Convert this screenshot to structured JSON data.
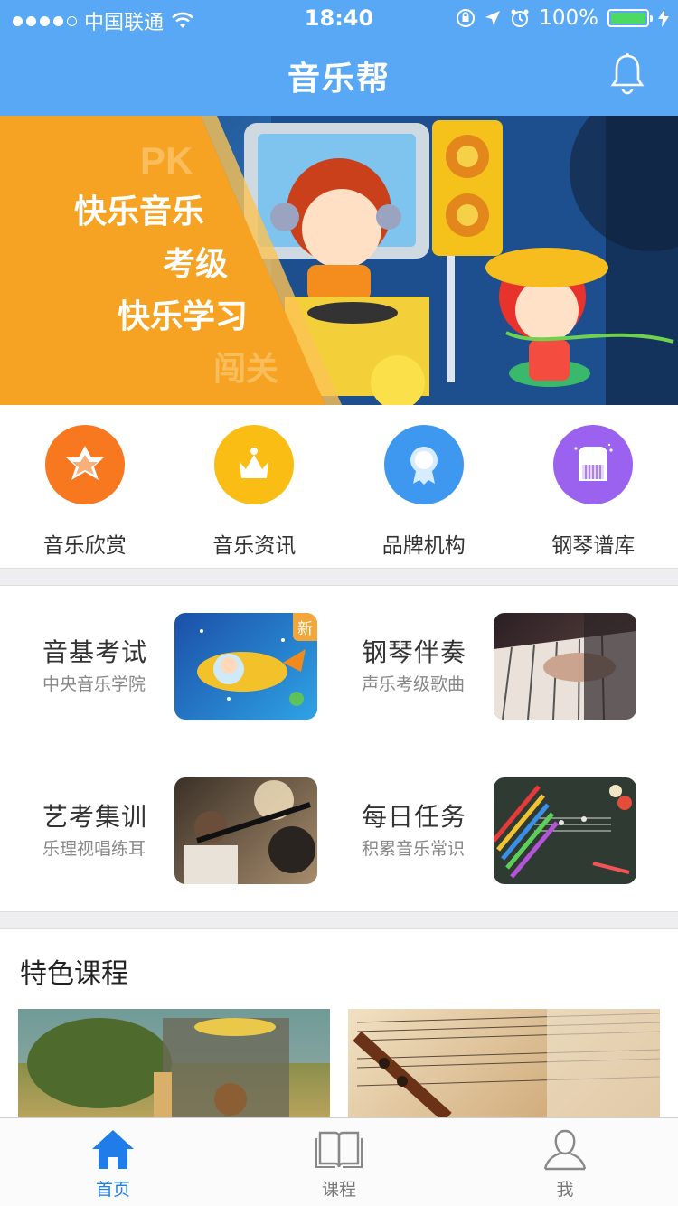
{
  "status": {
    "carrier": "中国联通",
    "time": "18:40",
    "battery": "100%"
  },
  "nav": {
    "title": "音乐帮"
  },
  "banner": {
    "lines": [
      "PK",
      "快乐音乐",
      "考级",
      "快乐学习",
      "闯关"
    ]
  },
  "quick": [
    {
      "label": "音乐欣赏",
      "icon": "star-icon",
      "color": "#f7781e"
    },
    {
      "label": "音乐资讯",
      "icon": "crown-icon",
      "color": "#f9bd13"
    },
    {
      "label": "品牌机构",
      "icon": "medal-icon",
      "color": "#3f98f0"
    },
    {
      "label": "钢琴谱库",
      "icon": "piano-icon",
      "color": "#9a62ee"
    }
  ],
  "features": [
    {
      "title": "音基考试",
      "subtitle": "中央音乐学院",
      "badge": "新"
    },
    {
      "title": "钢琴伴奏",
      "subtitle": "声乐考级歌曲"
    },
    {
      "title": "艺考集训",
      "subtitle": "乐理视唱练耳"
    },
    {
      "title": "每日任务",
      "subtitle": "积累音乐常识"
    }
  ],
  "section": {
    "title": "特色课程"
  },
  "tabs": [
    {
      "label": "首页",
      "icon": "home-icon"
    },
    {
      "label": "课程",
      "icon": "book-icon"
    },
    {
      "label": "我",
      "icon": "user-icon"
    }
  ],
  "colors": {
    "header": "#58a8f5",
    "tab_active": "#1f7ce8",
    "banner_orange": "#f6a324"
  }
}
